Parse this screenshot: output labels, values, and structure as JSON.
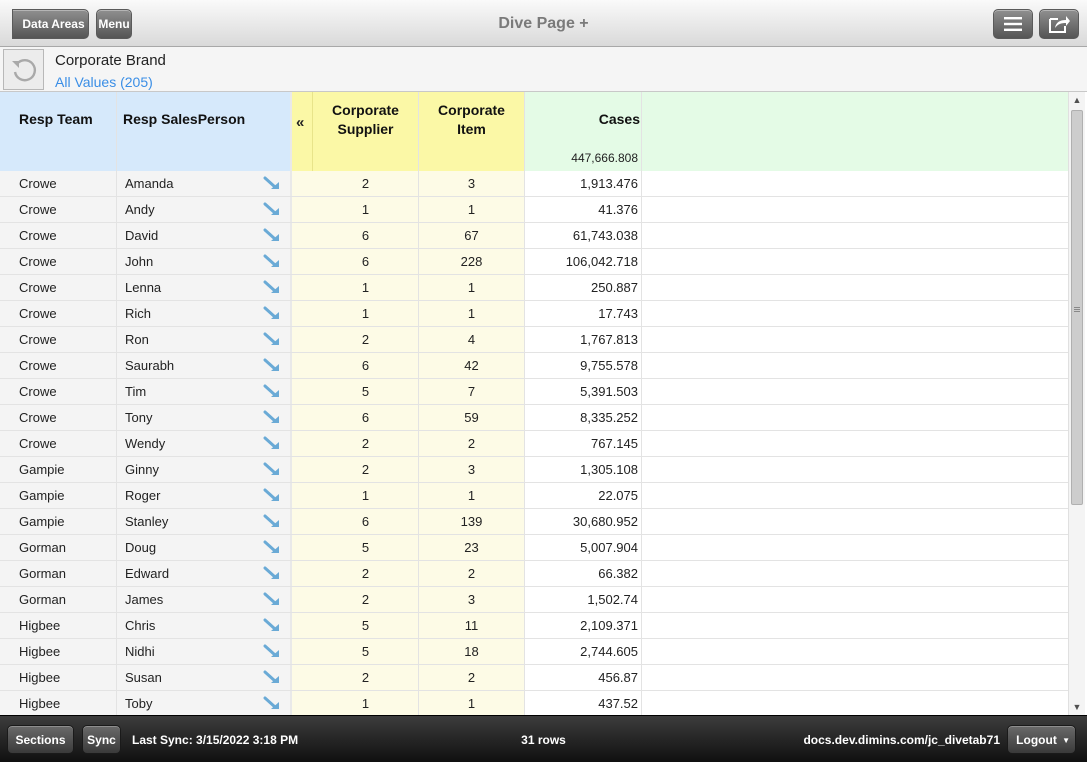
{
  "topbar": {
    "back_label": "Data Areas",
    "menu_label": "Menu",
    "title": "Dive Page +"
  },
  "filter": {
    "name": "Corporate Brand",
    "value": "All Values (205)"
  },
  "table": {
    "columns": {
      "team": "Resp Team",
      "salesperson": "Resp SalesPerson",
      "supplier": "Corporate\nSupplier",
      "item": "Corporate\nItem",
      "cases": "Cases"
    },
    "collapse_glyph": "«",
    "cases_total": "447,666.808",
    "rows": [
      {
        "team": "Crowe",
        "salesperson": "Amanda",
        "supplier": "2",
        "item": "3",
        "cases": "1,913.476"
      },
      {
        "team": "Crowe",
        "salesperson": "Andy",
        "supplier": "1",
        "item": "1",
        "cases": "41.376"
      },
      {
        "team": "Crowe",
        "salesperson": "David",
        "supplier": "6",
        "item": "67",
        "cases": "61,743.038"
      },
      {
        "team": "Crowe",
        "salesperson": "John",
        "supplier": "6",
        "item": "228",
        "cases": "106,042.718"
      },
      {
        "team": "Crowe",
        "salesperson": "Lenna",
        "supplier": "1",
        "item": "1",
        "cases": "250.887"
      },
      {
        "team": "Crowe",
        "salesperson": "Rich",
        "supplier": "1",
        "item": "1",
        "cases": "17.743"
      },
      {
        "team": "Crowe",
        "salesperson": "Ron",
        "supplier": "2",
        "item": "4",
        "cases": "1,767.813"
      },
      {
        "team": "Crowe",
        "salesperson": "Saurabh",
        "supplier": "6",
        "item": "42",
        "cases": "9,755.578"
      },
      {
        "team": "Crowe",
        "salesperson": "Tim",
        "supplier": "5",
        "item": "7",
        "cases": "5,391.503"
      },
      {
        "team": "Crowe",
        "salesperson": "Tony",
        "supplier": "6",
        "item": "59",
        "cases": "8,335.252"
      },
      {
        "team": "Crowe",
        "salesperson": "Wendy",
        "supplier": "2",
        "item": "2",
        "cases": "767.145"
      },
      {
        "team": "Gampie",
        "salesperson": "Ginny",
        "supplier": "2",
        "item": "3",
        "cases": "1,305.108"
      },
      {
        "team": "Gampie",
        "salesperson": "Roger",
        "supplier": "1",
        "item": "1",
        "cases": "22.075"
      },
      {
        "team": "Gampie",
        "salesperson": "Stanley",
        "supplier": "6",
        "item": "139",
        "cases": "30,680.952"
      },
      {
        "team": "Gorman",
        "salesperson": "Doug",
        "supplier": "5",
        "item": "23",
        "cases": "5,007.904"
      },
      {
        "team": "Gorman",
        "salesperson": "Edward",
        "supplier": "2",
        "item": "2",
        "cases": "66.382"
      },
      {
        "team": "Gorman",
        "salesperson": "James",
        "supplier": "2",
        "item": "3",
        "cases": "1,502.74"
      },
      {
        "team": "Higbee",
        "salesperson": "Chris",
        "supplier": "5",
        "item": "11",
        "cases": "2,109.371"
      },
      {
        "team": "Higbee",
        "salesperson": "Nidhi",
        "supplier": "5",
        "item": "18",
        "cases": "2,744.605"
      },
      {
        "team": "Higbee",
        "salesperson": "Susan",
        "supplier": "2",
        "item": "2",
        "cases": "456.87"
      },
      {
        "team": "Higbee",
        "salesperson": "Toby",
        "supplier": "1",
        "item": "1",
        "cases": "437.52"
      }
    ]
  },
  "bottombar": {
    "sections_label": "Sections",
    "sync_label": "Sync",
    "last_sync": "Last Sync: 3/15/2022 3:18 PM",
    "row_count": "31 rows",
    "site": "docs.dev.dimins.com/jc_divetab71",
    "logout_label": "Logout"
  },
  "colors": {
    "header_blue": "#d6e9fb",
    "header_yellow": "#fbf8a6",
    "header_green": "#e4fbe6",
    "link_blue": "#3a8ee6",
    "drill_icon": "#6aaad6"
  },
  "icons": {
    "reset": "rotate-ccw-icon",
    "list": "list-icon",
    "share": "share-icon",
    "drill": "drill-arrow-icon"
  }
}
